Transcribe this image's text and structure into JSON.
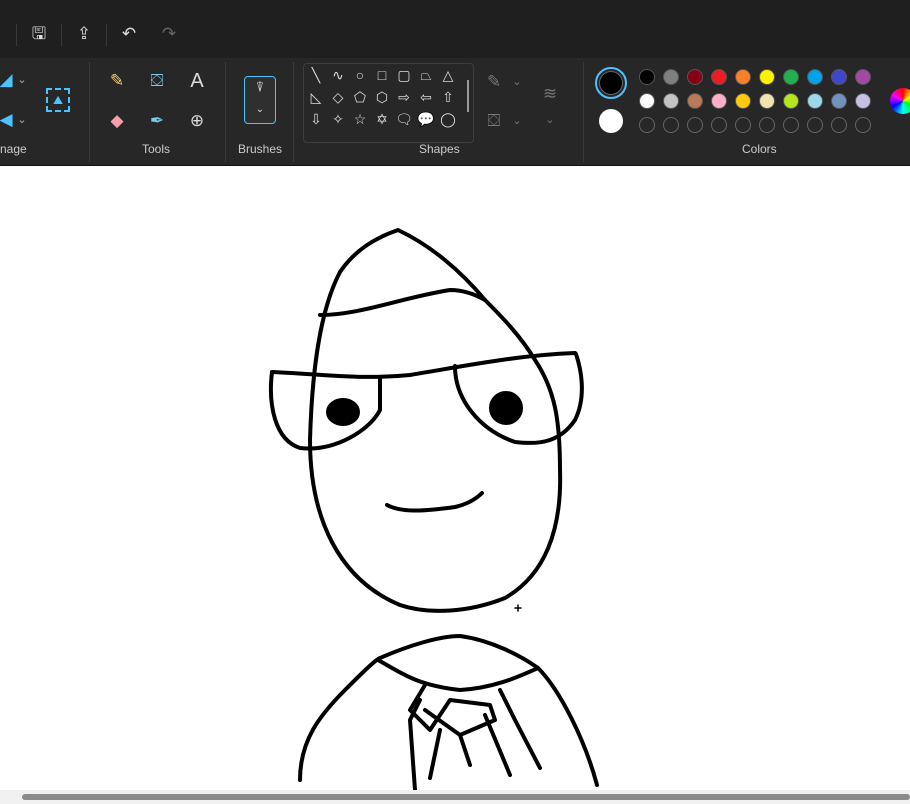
{
  "ribbon": {
    "groups": {
      "image": "nage",
      "tools": "Tools",
      "brushes": "Brushes",
      "shapes": "Shapes",
      "colors": "Colors"
    }
  },
  "icons": {
    "tools": [
      "pencil-icon",
      "fill-icon",
      "text-icon",
      "eraser-icon",
      "color-picker-icon",
      "magnifier-icon"
    ]
  },
  "colors": {
    "primary": "#000000",
    "secondary": "#ffffff",
    "row1": [
      "#000000",
      "#7f7f7f",
      "#880015",
      "#ed1c24",
      "#ff7f27",
      "#fff200",
      "#22b14c",
      "#00a2e8",
      "#3f48cc",
      "#a349a4"
    ],
    "row2": [
      "#ffffff",
      "#c3c3c3",
      "#b97a57",
      "#ffaec9",
      "#ffc90e",
      "#efe4b0",
      "#b5e61d",
      "#99d9ea",
      "#7092be",
      "#c8bfe7"
    ],
    "accent": "#4cc2ff"
  },
  "shapes": [
    "╲",
    "∿",
    "○",
    "□",
    "▢",
    "⏢",
    "△",
    "◺",
    "◇",
    "⬠",
    "⬡",
    "⇨",
    "⇦",
    "⇧",
    "⇩",
    "✧",
    "☆",
    "✡",
    "🗨",
    "💬",
    "◯"
  ]
}
